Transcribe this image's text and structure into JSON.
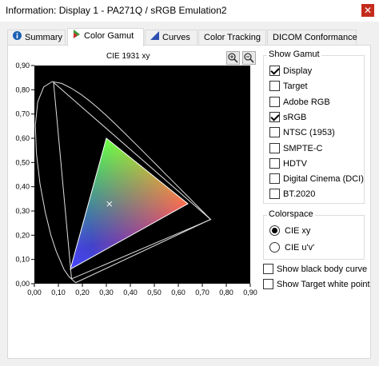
{
  "window": {
    "title": "Information: Display 1 - PA271Q / sRGB Emulation2",
    "close_glyph": "✕"
  },
  "tabs": [
    {
      "label": "Summary",
      "icon": "info-icon",
      "active": false
    },
    {
      "label": "Color Gamut",
      "icon": "gamut-icon",
      "active": true
    },
    {
      "label": "Curves",
      "icon": "curves-icon",
      "active": false
    },
    {
      "label": "Color Tracking",
      "active": false
    },
    {
      "label": "DICOM Conformance",
      "active": false
    }
  ],
  "chart": {
    "title": "CIE 1931 xy",
    "zoom_in": "zoom-in-icon",
    "zoom_out": "zoom-out-icon"
  },
  "chart_data": {
    "type": "scatter",
    "title": "CIE 1931 xy",
    "xlim": [
      0,
      0.9
    ],
    "ylim": [
      0,
      0.9
    ],
    "x_ticks": [
      "0,00",
      "0,10",
      "0,20",
      "0,30",
      "0,40",
      "0,50",
      "0,60",
      "0,70",
      "0,80",
      "0,90"
    ],
    "y_ticks": [
      "0,00",
      "0,10",
      "0,20",
      "0,30",
      "0,40",
      "0,50",
      "0,60",
      "0,70",
      "0,80",
      "0,90"
    ],
    "display_gamut": [
      [
        0.64,
        0.33
      ],
      [
        0.3,
        0.6
      ],
      [
        0.15,
        0.06
      ]
    ],
    "white_point": [
      0.3127,
      0.329
    ],
    "outer_gamut": [
      [
        0.735,
        0.265
      ],
      [
        0.155,
        0.02
      ],
      [
        0.08,
        0.83
      ]
    ],
    "spectral_locus": [
      [
        0.1741,
        0.005
      ],
      [
        0.1738,
        0.0049
      ],
      [
        0.1733,
        0.0048
      ],
      [
        0.1726,
        0.0048
      ],
      [
        0.1714,
        0.0051
      ],
      [
        0.1689,
        0.0069
      ],
      [
        0.1644,
        0.0109
      ],
      [
        0.1566,
        0.0177
      ],
      [
        0.144,
        0.0297
      ],
      [
        0.1241,
        0.0578
      ],
      [
        0.0913,
        0.1327
      ],
      [
        0.0687,
        0.2007
      ],
      [
        0.0454,
        0.295
      ],
      [
        0.0235,
        0.4127
      ],
      [
        0.0082,
        0.5384
      ],
      [
        0.0039,
        0.6548
      ],
      [
        0.0139,
        0.7502
      ],
      [
        0.0389,
        0.812
      ],
      [
        0.0743,
        0.8338
      ],
      [
        0.1142,
        0.8262
      ],
      [
        0.1547,
        0.8059
      ],
      [
        0.1929,
        0.7816
      ],
      [
        0.2296,
        0.7543
      ],
      [
        0.2658,
        0.7243
      ],
      [
        0.3016,
        0.6923
      ],
      [
        0.3373,
        0.6589
      ],
      [
        0.3731,
        0.6245
      ],
      [
        0.4087,
        0.5896
      ],
      [
        0.4441,
        0.5547
      ],
      [
        0.4788,
        0.5202
      ],
      [
        0.5125,
        0.4866
      ],
      [
        0.5448,
        0.4544
      ],
      [
        0.5752,
        0.4242
      ],
      [
        0.6029,
        0.3965
      ],
      [
        0.627,
        0.3725
      ],
      [
        0.6482,
        0.3514
      ],
      [
        0.6658,
        0.334
      ],
      [
        0.6801,
        0.3197
      ],
      [
        0.6915,
        0.3083
      ],
      [
        0.7006,
        0.2993
      ],
      [
        0.7079,
        0.292
      ],
      [
        0.714,
        0.2859
      ],
      [
        0.719,
        0.2809
      ],
      [
        0.723,
        0.277
      ],
      [
        0.726,
        0.274
      ],
      [
        0.7283,
        0.2717
      ],
      [
        0.73,
        0.27
      ],
      [
        0.7347,
        0.2653
      ],
      [
        0.1741,
        0.005
      ]
    ]
  },
  "show_gamut": {
    "label": "Show Gamut",
    "items": [
      {
        "label": "Display",
        "checked": true
      },
      {
        "label": "Target",
        "checked": false
      },
      {
        "label": "Adobe RGB",
        "checked": false
      },
      {
        "label": "sRGB",
        "checked": true
      },
      {
        "label": "NTSC (1953)",
        "checked": false
      },
      {
        "label": "SMPTE-C",
        "checked": false
      },
      {
        "label": "HDTV",
        "checked": false
      },
      {
        "label": "Digital Cinema (DCI)",
        "checked": false
      },
      {
        "label": "BT.2020",
        "checked": false
      }
    ]
  },
  "colorspace": {
    "label": "Colorspace",
    "options": [
      {
        "label": "CIE xy",
        "selected": true
      },
      {
        "label": "CIE u'v'",
        "selected": false
      }
    ]
  },
  "extra": [
    {
      "label": "Show black body curve",
      "checked": false
    },
    {
      "label": "Show Target white point",
      "checked": false
    }
  ]
}
